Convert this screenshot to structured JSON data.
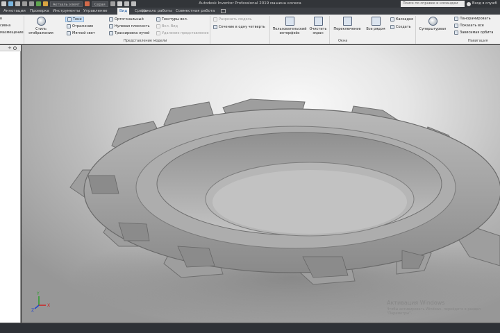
{
  "titlebar": {
    "quick_access_combo": "Актуаль элемт",
    "material_combo": "Серая",
    "app_title": "Autodesk Inventor Professional 2019   машина колеса",
    "search_placeholder": "Поиск по справке и командам",
    "signin_label": "Вход в служб"
  },
  "tabs": [
    "Аннотации",
    "Проверка",
    "Инструменты",
    "Управление",
    "Вид",
    "Среды",
    "Начало работы",
    "Совместная работа"
  ],
  "active_tab": "Вид",
  "ribbon": {
    "col0": [
      "в",
      "сивна",
      "мазмещение"
    ],
    "appearance": {
      "visual_style": "Стиль отображения",
      "shadows": "Тени",
      "reflection": "Отражение",
      "soft_light": "Мягкий свет",
      "orthographic": "Ортогональный",
      "ground_plane": "Нулевая плоскость",
      "ray_tracing": "Трассировка лучей",
      "textures": "Текстуры вкл.",
      "hide_view": "Вкл. Вид",
      "transparency": "Удаление представление",
      "panel_title": "Представление модели"
    },
    "half_section": "Разрезать модель",
    "quarter_section": "Сечение в одну четверть",
    "windows": {
      "user_interface": "Пользовательский интерфейс",
      "clean_screen": "Очистить экран",
      "switch": "Переключение",
      "arrange_all": "Все рядом",
      "cascade": "Каскадно",
      "new": "Создать",
      "panel_title": "Окна"
    },
    "navigation": {
      "steering_wheels": "Суперштурвал",
      "pan": "Панорамировать",
      "zoom_all": "Показать все",
      "orbit": "Зависимая орбита",
      "panel_title": "Навигация"
    }
  },
  "viewport": {
    "watermark_title": "Активация Windows",
    "watermark_sub": "Чтобы активировать Windows, перейдите в раздел \"Параметры\".",
    "axes": {
      "x": "X",
      "y": "Y",
      "z": "Z"
    }
  },
  "colors": {
    "titlebar_bg": "#323539",
    "tab_active": "#1b5aa6",
    "ribbon_bg": "#f0f0f0",
    "part_gray": "#9c9c9c"
  }
}
